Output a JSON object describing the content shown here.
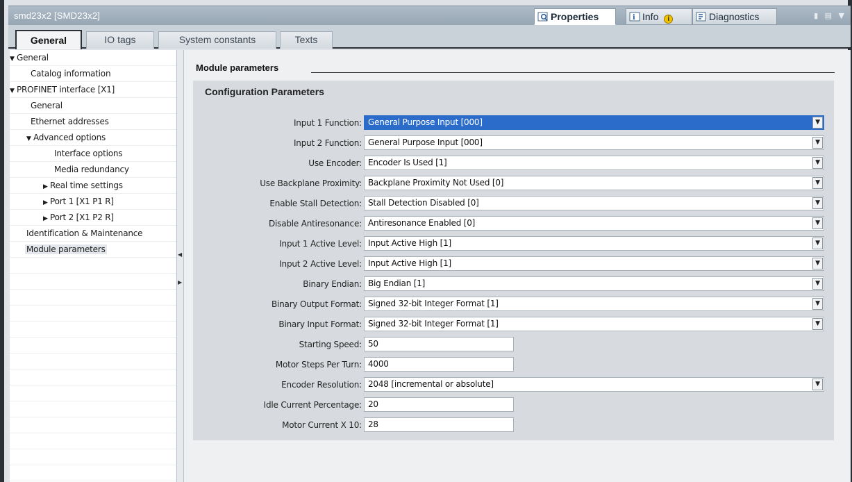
{
  "window": {
    "title": "smd23x2 [SMD23x2]",
    "tabs": [
      {
        "label": "Properties",
        "active": true
      },
      {
        "label": "Info",
        "active": false
      },
      {
        "label": "Diagnostics",
        "active": false
      }
    ]
  },
  "main_tabs": [
    {
      "label": "General",
      "active": true
    },
    {
      "label": "IO tags",
      "active": false
    },
    {
      "label": "System constants",
      "active": false
    },
    {
      "label": "Texts",
      "active": false
    }
  ],
  "nav": {
    "items": [
      {
        "label": "General",
        "arrow": "▼",
        "indent": 0
      },
      {
        "label": "Catalog information",
        "arrow": "",
        "indent": 2
      },
      {
        "label": "PROFINET interface [X1]",
        "arrow": "▼",
        "indent": 0
      },
      {
        "label": "General",
        "arrow": "",
        "indent": 2
      },
      {
        "label": "Ethernet addresses",
        "arrow": "",
        "indent": 2
      },
      {
        "label": "Advanced options",
        "arrow": "▼",
        "indent": 2
      },
      {
        "label": "Interface options",
        "arrow": "",
        "indent": 4
      },
      {
        "label": "Media redundancy",
        "arrow": "",
        "indent": 4
      },
      {
        "label": "Real time settings",
        "arrow": "▶",
        "indent": 3
      },
      {
        "label": "Port 1 [X1 P1 R]",
        "arrow": "▶",
        "indent": 3
      },
      {
        "label": "Port 2 [X1 P2 R]",
        "arrow": "▶",
        "indent": 3
      },
      {
        "label": "Identification & Maintenance",
        "arrow": "",
        "indent": 1
      },
      {
        "label": "Module parameters",
        "arrow": "",
        "indent": 1,
        "selected": true
      }
    ]
  },
  "content": {
    "section_title": "Module parameters",
    "panel_title": "Configuration Parameters",
    "params": [
      {
        "label": "Input 1 Function:",
        "value": "General Purpose Input [000]",
        "kind": "select",
        "selected": true
      },
      {
        "label": "Input 2 Function:",
        "value": "General Purpose Input [000]",
        "kind": "select"
      },
      {
        "label": "Use Encoder:",
        "value": "Encoder Is Used [1]",
        "kind": "select"
      },
      {
        "label": "Use Backplane Proximity:",
        "value": "Backplane Proximity Not Used [0]",
        "kind": "select"
      },
      {
        "label": "Enable Stall Detection:",
        "value": "Stall Detection Disabled [0]",
        "kind": "select"
      },
      {
        "label": "Disable Antiresonance:",
        "value": "Antiresonance Enabled [0]",
        "kind": "select"
      },
      {
        "label": "Input 1 Active Level:",
        "value": "Input Active High [1]",
        "kind": "select"
      },
      {
        "label": "Input 2 Active Level:",
        "value": "Input Active High [1]",
        "kind": "select"
      },
      {
        "label": "Binary Endian:",
        "value": "Big Endian [1]",
        "kind": "select"
      },
      {
        "label": "Binary Output Format:",
        "value": "Signed 32-bit Integer Format [1]",
        "kind": "select"
      },
      {
        "label": "Binary Input Format:",
        "value": "Signed 32-bit Integer Format [1]",
        "kind": "select"
      },
      {
        "label": "Starting Speed:",
        "value": "50",
        "kind": "text"
      },
      {
        "label": "Motor Steps Per Turn:",
        "value": "4000",
        "kind": "text"
      },
      {
        "label": "Encoder Resolution:",
        "value": "2048 [incremental or absolute]",
        "kind": "select"
      },
      {
        "label": "Idle Current Percentage:",
        "value": "20",
        "kind": "text"
      },
      {
        "label": "Motor Current X 10:",
        "value": "28",
        "kind": "text"
      }
    ]
  },
  "colors": {
    "selection": "#2b6ccb",
    "titlebar": "#a3b1be",
    "panel": "#d7dbdf",
    "frame": "#2a2f36"
  }
}
